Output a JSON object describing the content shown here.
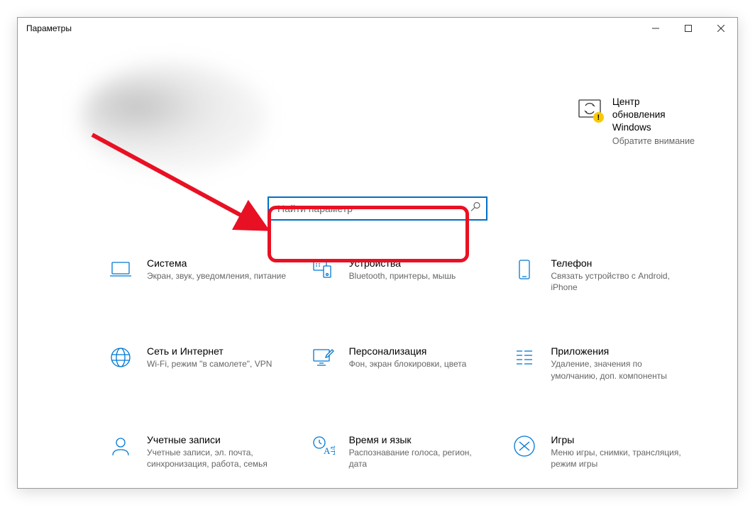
{
  "window": {
    "title": "Параметры"
  },
  "update": {
    "title_line1": "Центр",
    "title_line2": "обновления",
    "title_line3": "Windows",
    "subtitle": "Обратите внимание",
    "badge": "!"
  },
  "search": {
    "placeholder": "Найти параметр"
  },
  "categories": [
    {
      "id": "system",
      "title": "Система",
      "desc": "Экран, звук, уведомления, питание",
      "icon": "laptop"
    },
    {
      "id": "devices",
      "title": "Устройства",
      "desc": "Bluetooth, принтеры, мышь",
      "icon": "devices"
    },
    {
      "id": "phone",
      "title": "Телефон",
      "desc": "Связать устройство с Android, iPhone",
      "icon": "phone"
    },
    {
      "id": "network",
      "title": "Сеть и Интернет",
      "desc": "Wi-Fi, режим \"в самолете\", VPN",
      "icon": "globe"
    },
    {
      "id": "personalization",
      "title": "Персонализация",
      "desc": "Фон, экран блокировки, цвета",
      "icon": "personalization"
    },
    {
      "id": "apps",
      "title": "Приложения",
      "desc": "Удаление, значения по умолчанию, доп. компоненты",
      "icon": "apps"
    },
    {
      "id": "accounts",
      "title": "Учетные записи",
      "desc": "Учетные записи, эл. почта, синхронизация, работа, семья",
      "icon": "accounts"
    },
    {
      "id": "time",
      "title": "Время и язык",
      "desc": "Распознавание голоса, регион, дата",
      "icon": "time"
    },
    {
      "id": "gaming",
      "title": "Игры",
      "desc": "Меню игры, снимки, трансляция, режим игры",
      "icon": "gaming"
    }
  ]
}
